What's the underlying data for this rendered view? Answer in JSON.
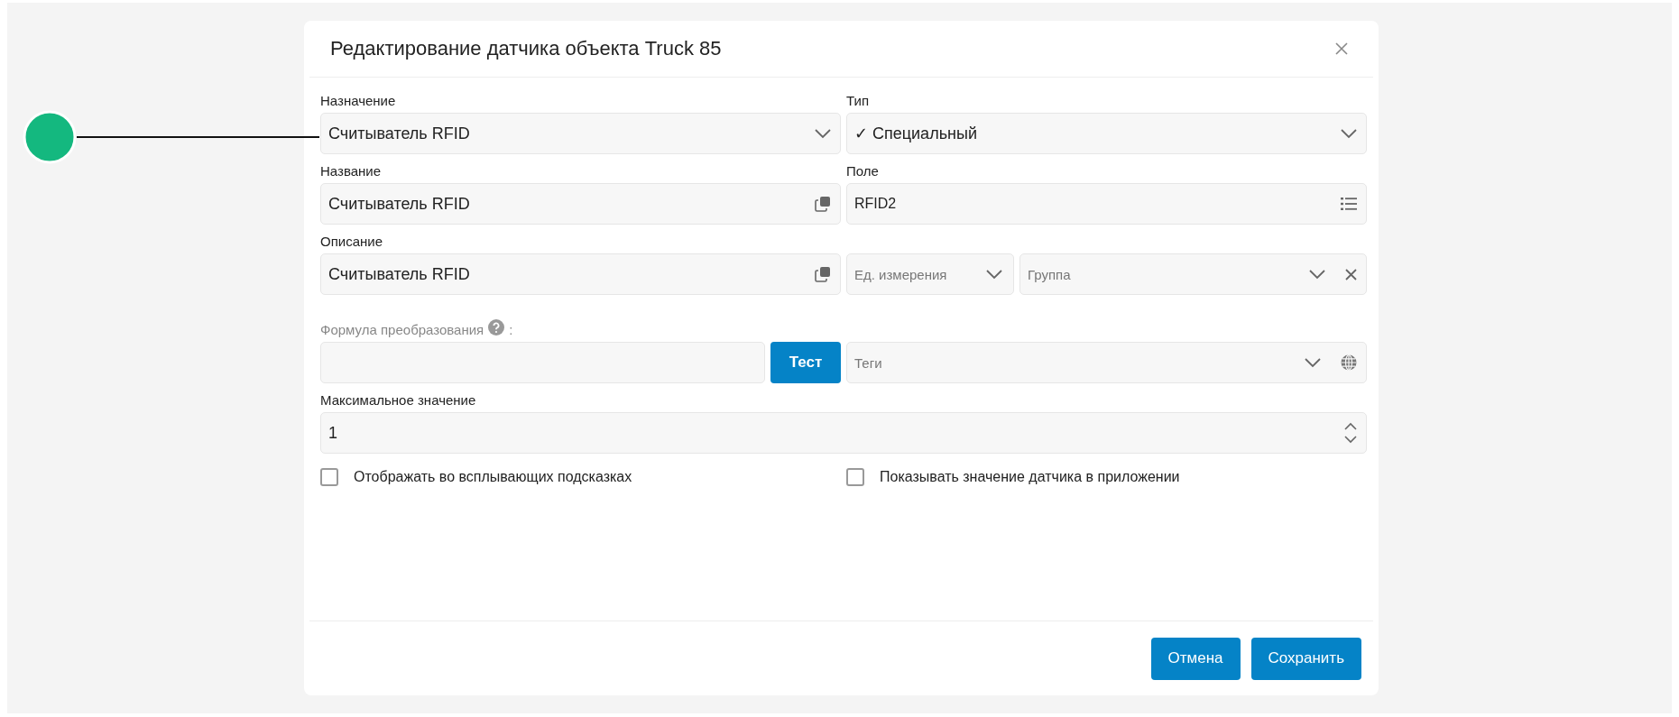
{
  "window": {
    "title": "Редактирование датчика объекта Truck 85"
  },
  "purpose": {
    "label": "Назначение",
    "value": "Считыватель RFID"
  },
  "type": {
    "label": "Тип",
    "value": "✓ Специальный"
  },
  "name": {
    "label": "Название",
    "value": "Считыватель RFID"
  },
  "field": {
    "label": "Поле",
    "value": "RFID2"
  },
  "description": {
    "label": "Описание",
    "value": "Считыватель RFID"
  },
  "unit": {
    "placeholder": "Ед. измерения"
  },
  "group": {
    "placeholder": "Группа"
  },
  "formula": {
    "label": "Формула преобразования",
    "colon": ":",
    "button": "Тест"
  },
  "tags": {
    "placeholder": "Теги"
  },
  "max_value": {
    "label": "Максимальное значение",
    "value": "1"
  },
  "checkboxes": [
    {
      "label": "Отображать во всплывающих подсказках",
      "checked": false
    },
    {
      "label": "Показывать значение датчика в приложении",
      "checked": false
    }
  ],
  "buttons": [
    "Отмена",
    "Сохранить"
  ]
}
